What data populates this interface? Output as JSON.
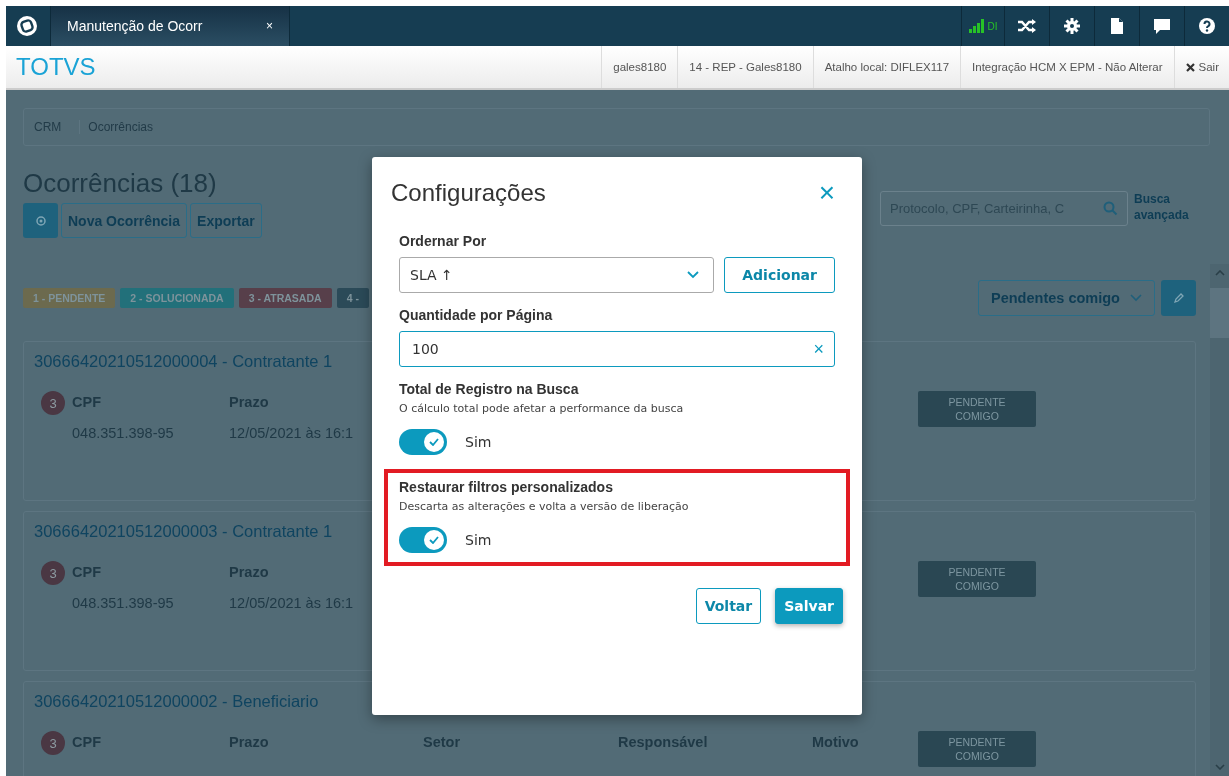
{
  "topbar": {
    "tabs": [
      {
        "label": "Manutenção de Ocorr",
        "selected": true,
        "close": "×"
      }
    ],
    "signal_text": "DI"
  },
  "header": {
    "logo": "TOTVS",
    "items": [
      "gales8180",
      "14 - REP - Gales8180",
      "Atalho local: DIFLEX117",
      "Integração HCM X EPM - Não Alterar"
    ],
    "logout": "Sair"
  },
  "breadcrumb": [
    "CRM",
    "Ocorrências"
  ],
  "page": {
    "title": "Ocorrências (18)",
    "buttons": [
      "Nova Ocorrência",
      "Exportar"
    ],
    "search": {
      "placeholder": "Protocolo, CPF, Carteirinha, C"
    },
    "advanced_search": "Busca avançada",
    "filter": "Pendentes comigo"
  },
  "legend": [
    {
      "label": "1 - PENDENTE",
      "color": "#6c6a4e"
    },
    {
      "label": "2 - SOLUCIONADA",
      "color": "#22707a"
    },
    {
      "label": "3 - ATRASADA",
      "color": "#573f4a"
    },
    {
      "label": "4 -",
      "color": "#2b4a58"
    }
  ],
  "cards": [
    {
      "title": "30666420210512000004 - Contratante 1",
      "badge": "3",
      "fields": [
        {
          "label": "CPF",
          "value": "048.351.398-95"
        },
        {
          "label": "Prazo",
          "value": "12/05/2021 às 16:1"
        }
      ],
      "status": "PENDENTE COMIGO"
    },
    {
      "title": "30666420210512000003 - Contratante 1",
      "badge": "3",
      "fields": [
        {
          "label": "CPF",
          "value": "048.351.398-95"
        },
        {
          "label": "Prazo",
          "value": "12/05/2021 às 16:1"
        }
      ],
      "status": "PENDENTE COMIGO"
    },
    {
      "title": "30666420210512000002 - Beneficiario",
      "badge": "3",
      "fields": [
        {
          "label": "CPF"
        },
        {
          "label": "Prazo"
        },
        {
          "label": "Setor"
        },
        {
          "label": "Responsável"
        },
        {
          "label": "Motivo"
        }
      ],
      "status": "PENDENTE COMIGO"
    }
  ],
  "dialog": {
    "title": "Configurações",
    "close": "×",
    "sections": [
      {
        "kind": "select",
        "label": "Ordernar Por",
        "value": "SLA ↑",
        "button": "Adicionar"
      },
      {
        "kind": "input",
        "label": "Quantidade por Página",
        "value": "100",
        "clear": "×"
      },
      {
        "kind": "toggle",
        "label": "Total de Registro na Busca",
        "description": "O cálculo total pode afetar a performance da busca",
        "on": true,
        "toggle_label": "Sim",
        "highlighted": false
      },
      {
        "kind": "toggle",
        "label": "Restaurar filtros personalizados",
        "description": "Descarta as alterações e volta a versão de liberação",
        "on": true,
        "toggle_label": "Sim",
        "highlighted": true
      }
    ],
    "buttons": [
      {
        "label": "Voltar",
        "primary": false
      },
      {
        "label": "Salvar",
        "primary": true
      }
    ]
  }
}
